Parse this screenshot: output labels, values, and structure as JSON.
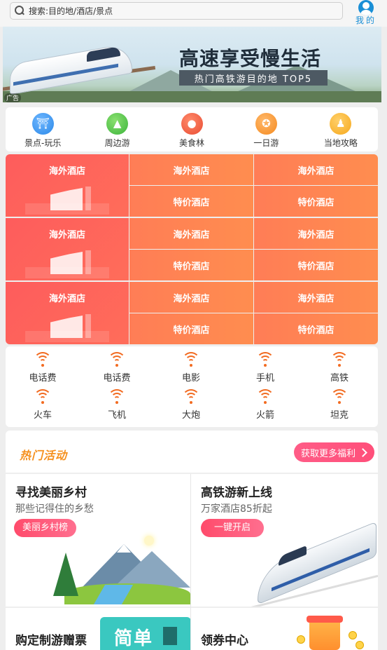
{
  "header": {
    "search_placeholder": "搜索:目的地/酒店/景点",
    "me_label": "我的"
  },
  "banner": {
    "title": "高速享受慢生活",
    "subtitle": "热门高铁游目的地 TOP5",
    "ad_tag": "广告"
  },
  "categories": [
    {
      "label": "景点-玩乐",
      "icon": "temple-icon",
      "color": "#2a88e8"
    },
    {
      "label": "周边游",
      "icon": "mountain-icon",
      "color": "#3cb43c"
    },
    {
      "label": "美食林",
      "icon": "food-icon",
      "color": "#e94c33"
    },
    {
      "label": "一日游",
      "icon": "star-badge-icon",
      "color": "#f58a1f"
    },
    {
      "label": "当地攻略",
      "icon": "location-icon",
      "color": "#f6a81c"
    }
  ],
  "hotels": [
    {
      "big": "海外酒店",
      "top_mid": "海外酒店",
      "top_right": "海外酒店",
      "bot_mid": "特价酒店",
      "bot_right": "特价酒店"
    },
    {
      "big": "海外酒店",
      "top_mid": "海外酒店",
      "top_right": "海外酒店",
      "bot_mid": "特价酒店",
      "bot_right": "特价酒店"
    },
    {
      "big": "海外酒店",
      "top_mid": "海外酒店",
      "top_right": "海外酒店",
      "bot_mid": "特价酒店",
      "bot_right": "特价酒店"
    }
  ],
  "services": [
    "电话费",
    "电话费",
    "电影",
    "手机",
    "高铁",
    "火车",
    "飞机",
    "大炮",
    "火箭",
    "坦克"
  ],
  "hot": {
    "title": "热门活动",
    "more_label": "获取更多福利"
  },
  "cards": [
    {
      "title": "寻找美丽乡村",
      "subtitle": "那些记得住的乡愁",
      "button": "美丽乡村榜"
    },
    {
      "title": "高铁游新上线",
      "subtitle": "万家酒店85折起",
      "button": "一键开启"
    },
    {
      "title": "购定制游赠票",
      "tile_text": "简单"
    },
    {
      "title": "领券中心"
    }
  ],
  "colors": {
    "accent_orange": "#f26b21",
    "brand_blue": "#1a8fd6",
    "pink": "#ff4f7a"
  }
}
